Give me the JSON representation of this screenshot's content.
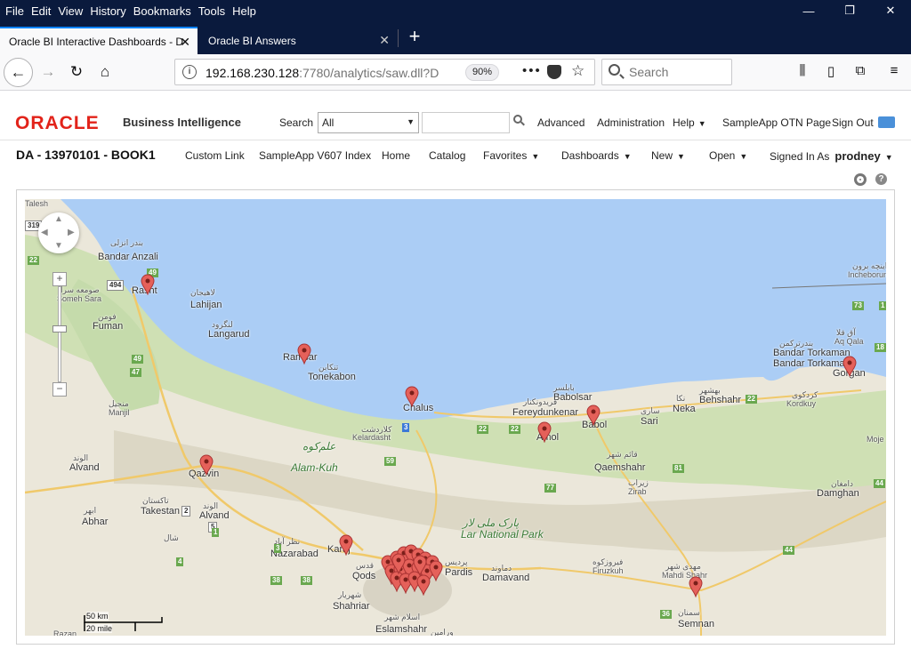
{
  "browser": {
    "menu": [
      "File",
      "Edit",
      "View",
      "History",
      "Bookmarks",
      "Tools",
      "Help"
    ],
    "window_controls": {
      "minimize": "—",
      "restore": "❐",
      "close": "✕"
    },
    "tabs": [
      {
        "title": "Oracle BI Interactive Dashboards - D",
        "active": true
      },
      {
        "title": "Oracle BI Answers",
        "active": false
      }
    ],
    "url_host": "192.168.230.128",
    "url_rest": ":7780/analytics/saw.dll?D",
    "zoom": "90%",
    "page_actions": "•••",
    "search_placeholder": "Search"
  },
  "obi": {
    "logo": "ORACLE",
    "product": "Business Intelligence",
    "search_label": "Search",
    "search_scope": "All",
    "header_links": {
      "advanced": "Advanced",
      "administration": "Administration",
      "help": "Help",
      "otn": "SampleApp OTN Page",
      "signout": "Sign Out"
    },
    "dashboard_title": "DA - 13970101 - BOOK1",
    "nav": {
      "custom_link": "Custom Link",
      "index": "SampleApp V607 Index",
      "home": "Home",
      "catalog": "Catalog",
      "favorites": "Favorites",
      "dashboards": "Dashboards",
      "new": "New",
      "open": "Open",
      "signed_in_as": "Signed In As",
      "user": "prodney"
    }
  },
  "map": {
    "colors": {
      "sea": "#abcdf5",
      "land": "#ebe7da",
      "forest": "#c9deb1",
      "mountain": "#d6d2c2",
      "marker": "#e5615a"
    },
    "labels": {
      "tbilisi_fragment": "Talesh",
      "bandar_anzali": "Bandar Anzali",
      "bandar_anzali_fa": "بندر انزلی",
      "rasht": "Rasht",
      "someh_sara": "Someh Sara",
      "someh_sara_fa": "صومعه سرا",
      "fuman": "Fuman",
      "fuman_fa": "فومن",
      "lahijan": "Lahijan",
      "lahijan_fa": "لاهیجان",
      "langarud": "Langarud",
      "langarud_fa": "لنگرود",
      "ramsar": "Ramsar",
      "tonekabon": "Tonekabon",
      "tonekabon_fa": "تنکابن",
      "chalus": "Chalus",
      "kelardasht": "Kelardasht",
      "kelardasht_fa": "کلاردشت",
      "alam_kuh": "Alam-Kuh",
      "alam_kuh_fa": "علم‌کوه",
      "fereydunkenar": "Fereydunkenar",
      "fereydunkenar_fa": "فریدونکنار",
      "babolsar": "Babolsar",
      "babolsar_fa": "بابلسر",
      "amol": "Amol",
      "babol": "Babol",
      "sari": "Sari",
      "sari_fa": "ساری",
      "neka": "Neka",
      "neka_fa": "نکا",
      "behshahr": "Behshahr",
      "behshahr_fa": "بهشهر",
      "qaemshahr": "Qaemshahr",
      "qaemshahr_fa": "قائم شهر",
      "zirab": "Zirab",
      "zirab_fa": "زیراب",
      "firuzkuh": "Firuzkuh",
      "firuzkuh_fa": "فیروزکوه",
      "bandar_torkaman": "Bandar Torkaman",
      "bandar_torkaman_fa": "بندرترکمن",
      "aq_qala": "Aq Qala",
      "aq_qala_fa": "آق قلا",
      "gorgan": "Gorgan",
      "kordkuy": "Kordkuy",
      "kordkuy_fa": "کردکوی",
      "incheborun": "Incheborun",
      "incheborun_fa": "اینچه برون",
      "damghan": "Damghan",
      "damghan_fa": "دامغان",
      "mojen": "Moje",
      "manjil": "Manjil",
      "manjil_fa": "منجیل",
      "alvand": "Alvand",
      "alvand_fa": "الوند",
      "qazvin": "Qazvin",
      "takestan": "Takestan",
      "takestan_fa": "تاکستان",
      "abhar": "Abhar",
      "abhar_fa": "ابهر",
      "alvand2": "Alvand",
      "alvand2_fa": "الوند",
      "nazarabad": "Nazarabad",
      "nazarabad_fa": "نظر آباد",
      "karaj": "Karaj",
      "qods": "Qods",
      "qods_fa": "قدس",
      "shahriar": "Shahriar",
      "shahriar_fa": "شهریار",
      "eslamshahr": "Eslamshahr",
      "eslamshahr_fa": "اسلام شهر",
      "pardis": "Pardis",
      "pardis_fa": "پردیس",
      "damavand": "Damavand",
      "damavand_fa": "دماوند",
      "lar_park": "Lar National Park",
      "lar_park_fa": "پارک ملی لار",
      "mahdi_shahr": "Mahdi Shahr",
      "mahdi_shahr_fa": "مهدی شهر",
      "semnan": "Semnan",
      "semnan_fa": "سمنان",
      "shal_fa": "شال",
      "razan": "Razan",
      "varamin_fa": "ورامین"
    },
    "roads": [
      "319",
      "22",
      "49",
      "494",
      "49",
      "47",
      "59",
      "3",
      "22",
      "22",
      "77",
      "81",
      "22",
      "44",
      "73",
      "18",
      "1",
      "38",
      "38",
      "36",
      "44",
      "3",
      "2",
      "5",
      "1",
      "4"
    ],
    "scale": {
      "km": "50 km",
      "mile": "20 mile"
    }
  }
}
